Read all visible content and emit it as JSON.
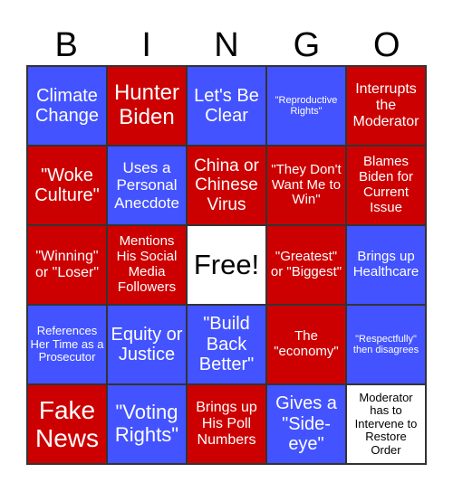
{
  "header": [
    "B",
    "I",
    "N",
    "G",
    "O"
  ],
  "colors": {
    "blue": "#4353FF",
    "red": "#CC0000",
    "free": "#FFFFFF"
  },
  "cells": [
    {
      "text": "Climate Change",
      "color": "blue"
    },
    {
      "text": "Hunter Biden",
      "color": "red"
    },
    {
      "text": "Let's Be Clear",
      "color": "blue"
    },
    {
      "text": "\"Reproductive Rights\"",
      "color": "blue"
    },
    {
      "text": "Interrupts the Moderator",
      "color": "red"
    },
    {
      "text": "\"Woke Culture\"",
      "color": "red"
    },
    {
      "text": "Uses a Personal Anecdote",
      "color": "blue"
    },
    {
      "text": "China or Chinese Virus",
      "color": "red"
    },
    {
      "text": "\"They Don't Want Me to Win\"",
      "color": "red"
    },
    {
      "text": "Blames Biden for Current Issue",
      "color": "red"
    },
    {
      "text": "\"Winning\" or \"Loser\"",
      "color": "red"
    },
    {
      "text": "Mentions His Social Media Followers",
      "color": "red"
    },
    {
      "text": "Free!",
      "color": "white"
    },
    {
      "text": "\"Greatest\" or \"Biggest\"",
      "color": "red"
    },
    {
      "text": "Brings up Healthcare",
      "color": "blue"
    },
    {
      "text": "References Her Time as a Prosecutor",
      "color": "blue"
    },
    {
      "text": "Equity or Justice",
      "color": "blue"
    },
    {
      "text": "\"Build Back Better\"",
      "color": "blue"
    },
    {
      "text": "The \"economy\"",
      "color": "red"
    },
    {
      "text": "\"Respectfully\" then disagrees",
      "color": "blue"
    },
    {
      "text": "Fake News",
      "color": "red"
    },
    {
      "text": "\"Voting Rights\"",
      "color": "blue"
    },
    {
      "text": "Brings up His Poll Numbers",
      "color": "red"
    },
    {
      "text": "Gives a \"Side-eye\"",
      "color": "blue"
    },
    {
      "text": "Moderator has to Intervene to Restore Order",
      "color": "white"
    }
  ]
}
